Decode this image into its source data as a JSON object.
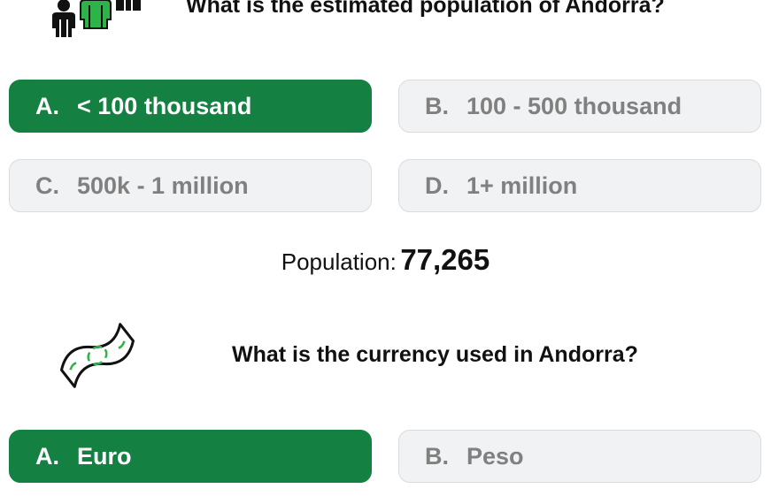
{
  "question1": {
    "text": "What is the estimated population of Andorra?",
    "icon": "people-icon",
    "options": [
      {
        "letter": "A.",
        "label": "< 100 thousand",
        "state": "correct"
      },
      {
        "letter": "B.",
        "label": "100 - 500 thousand",
        "state": "neutral"
      },
      {
        "letter": "C.",
        "label": "500k - 1 million",
        "state": "neutral"
      },
      {
        "letter": "D.",
        "label": "1+ million",
        "state": "neutral"
      }
    ],
    "result_label": "Population:",
    "result_value": "77,265"
  },
  "question2": {
    "text": "What is the currency used in Andorra?",
    "icon": "banknote-icon",
    "options": [
      {
        "letter": "A.",
        "label": "Euro",
        "state": "correct"
      },
      {
        "letter": "B.",
        "label": "Peso",
        "state": "neutral"
      }
    ]
  },
  "colors": {
    "correct_bg": "#148042",
    "neutral_bg": "#f1f2f4",
    "neutral_text": "#808080",
    "icon_green": "#2db34a"
  }
}
